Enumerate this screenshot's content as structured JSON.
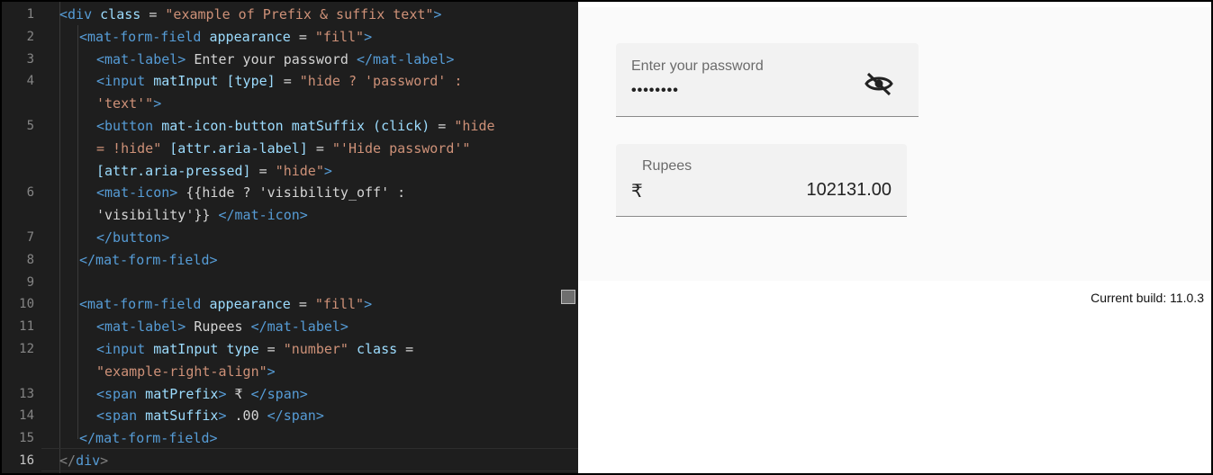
{
  "editor": {
    "active_line": "16",
    "lines": [
      {
        "num": "1",
        "indent": 64,
        "tokens": [
          [
            "t-tag",
            "<div"
          ],
          [
            "t-attr",
            " class"
          ],
          [
            "t-txt",
            " = "
          ],
          [
            "t-str",
            "\"example of Prefix & suffix text\""
          ],
          [
            "t-tag",
            ">"
          ]
        ]
      },
      {
        "num": "2",
        "indent": 86,
        "tokens": [
          [
            "t-tag",
            "<mat-form-field"
          ],
          [
            "t-attr",
            " appearance"
          ],
          [
            "t-txt",
            " = "
          ],
          [
            "t-str",
            "\"fill\""
          ],
          [
            "t-tag",
            ">"
          ]
        ]
      },
      {
        "num": "3",
        "indent": 105,
        "tokens": [
          [
            "t-tag",
            "<mat-label>"
          ],
          [
            "t-txt",
            " Enter your password "
          ],
          [
            "t-tag",
            "</mat-label>"
          ]
        ]
      },
      {
        "num": "4",
        "indent": 105,
        "tokens": [
          [
            "t-tag",
            "<input"
          ],
          [
            "t-attr",
            " matInput"
          ],
          [
            "t-attr",
            " [type]"
          ],
          [
            "t-txt",
            " = "
          ],
          [
            "t-str",
            "\"hide ? 'password' :"
          ]
        ]
      },
      {
        "num": "",
        "indent": 105,
        "tokens": [
          [
            "t-str",
            "'text'\""
          ],
          [
            "t-tag",
            ">"
          ]
        ]
      },
      {
        "num": "5",
        "indent": 105,
        "tokens": [
          [
            "t-tag",
            "<button"
          ],
          [
            "t-attr",
            " mat-icon-button"
          ],
          [
            "t-attr",
            " matSuffix"
          ],
          [
            "t-attr",
            " (click)"
          ],
          [
            "t-txt",
            " = "
          ],
          [
            "t-str",
            "\"hide"
          ]
        ]
      },
      {
        "num": "",
        "indent": 105,
        "tokens": [
          [
            "t-str",
            "= !hide\""
          ],
          [
            "t-attr",
            " [attr.aria-label]"
          ],
          [
            "t-txt",
            " = "
          ],
          [
            "t-str",
            "\"'Hide password'\""
          ]
        ]
      },
      {
        "num": "",
        "indent": 105,
        "tokens": [
          [
            "t-attr",
            "[attr.aria-pressed]"
          ],
          [
            "t-txt",
            " = "
          ],
          [
            "t-str",
            "\"hide\""
          ],
          [
            "t-tag",
            ">"
          ]
        ]
      },
      {
        "num": "6",
        "indent": 105,
        "tokens": [
          [
            "t-tag",
            "<mat-icon>"
          ],
          [
            "t-txt",
            " {{hide ? 'visibility_off' :"
          ]
        ]
      },
      {
        "num": "",
        "indent": 105,
        "tokens": [
          [
            "t-txt",
            "'visibility'}} "
          ],
          [
            "t-tag",
            "</mat-icon>"
          ]
        ]
      },
      {
        "num": "7",
        "indent": 105,
        "tokens": [
          [
            "t-tag",
            "</button>"
          ]
        ]
      },
      {
        "num": "8",
        "indent": 86,
        "tokens": [
          [
            "t-tag",
            "</mat-form-field>"
          ]
        ]
      },
      {
        "num": "9",
        "indent": 86,
        "tokens": []
      },
      {
        "num": "10",
        "indent": 86,
        "tokens": [
          [
            "t-tag",
            "<mat-form-field"
          ],
          [
            "t-attr",
            " appearance"
          ],
          [
            "t-txt",
            " = "
          ],
          [
            "t-str",
            "\"fill\""
          ],
          [
            "t-tag",
            ">"
          ]
        ]
      },
      {
        "num": "11",
        "indent": 105,
        "tokens": [
          [
            "t-tag",
            "<mat-label>"
          ],
          [
            "t-txt",
            " Rupees "
          ],
          [
            "t-tag",
            "</mat-label>"
          ]
        ]
      },
      {
        "num": "12",
        "indent": 105,
        "tokens": [
          [
            "t-tag",
            "<input"
          ],
          [
            "t-attr",
            " matInput"
          ],
          [
            "t-attr",
            " type"
          ],
          [
            "t-txt",
            " = "
          ],
          [
            "t-str",
            "\"number\""
          ],
          [
            "t-attr",
            " class"
          ],
          [
            "t-txt",
            " ="
          ]
        ]
      },
      {
        "num": "",
        "indent": 105,
        "tokens": [
          [
            "t-str",
            "\"example-right-align\""
          ],
          [
            "t-tag",
            ">"
          ]
        ]
      },
      {
        "num": "13",
        "indent": 105,
        "tokens": [
          [
            "t-tag",
            "<span"
          ],
          [
            "t-attr",
            " matPrefix"
          ],
          [
            "t-tag",
            ">"
          ],
          [
            "t-txt",
            " ₹ "
          ],
          [
            "t-tag",
            "</span>"
          ]
        ]
      },
      {
        "num": "14",
        "indent": 105,
        "tokens": [
          [
            "t-tag",
            "<span"
          ],
          [
            "t-attr",
            " matSuffix"
          ],
          [
            "t-tag",
            ">"
          ],
          [
            "t-txt",
            " .00 "
          ],
          [
            "t-tag",
            "</span>"
          ]
        ]
      },
      {
        "num": "15",
        "indent": 86,
        "tokens": [
          [
            "t-tag",
            "</mat-form-field>"
          ]
        ]
      },
      {
        "num": "16",
        "indent": 64,
        "tokens": [
          [
            "t-punc",
            "</"
          ],
          [
            "t-tag",
            "div"
          ],
          [
            "t-punc",
            ">"
          ]
        ]
      }
    ]
  },
  "preview": {
    "password_field": {
      "label": "Enter your password",
      "value": "••••••••",
      "icon": "visibility-off-icon"
    },
    "rupees_field": {
      "label": "Rupees",
      "prefix": "₹",
      "value": "102131.00"
    },
    "build_text": "Current build: 11.0.3"
  }
}
